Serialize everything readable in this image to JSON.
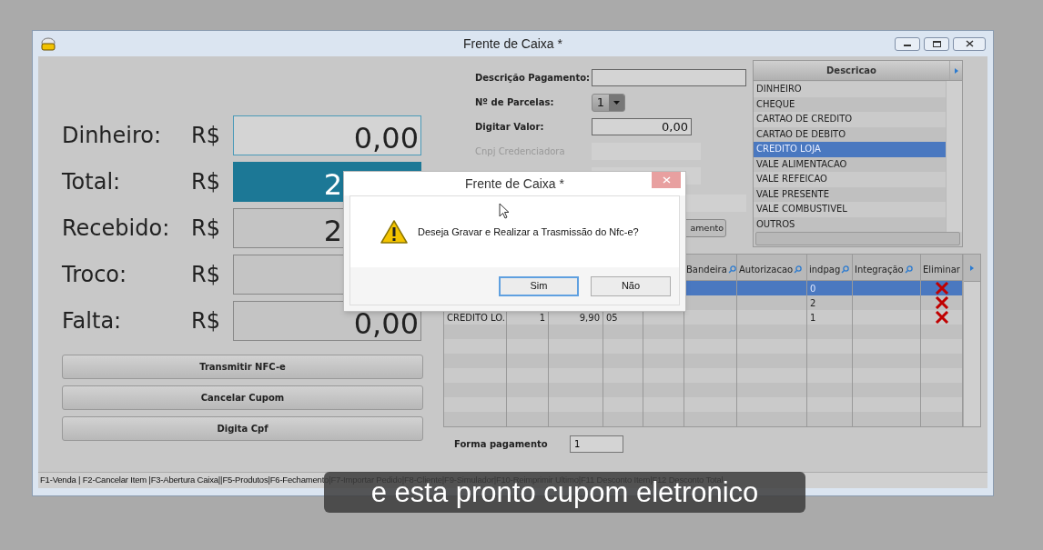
{
  "window": {
    "title": "Frente de Caixa  *"
  },
  "totals": [
    {
      "label": "Dinheiro:",
      "currency": "R$",
      "value": "0,00",
      "kind": "focused"
    },
    {
      "label": "Total:",
      "currency": "R$",
      "value": "2",
      "kind": "highlight"
    },
    {
      "label": "Recebido:",
      "currency": "R$",
      "value": "2",
      "kind": "plain"
    },
    {
      "label": "Troco:",
      "currency": "R$",
      "kind": "plain"
    },
    {
      "label": "Falta:",
      "currency": "R$",
      "value": "0,00",
      "kind": "plain"
    }
  ],
  "actions": [
    "Transmitir NFC-e",
    "Cancelar Cupom",
    "Digita Cpf"
  ],
  "payment_form": {
    "fields": [
      {
        "label": "Descrição Pagamento:",
        "kind": "text",
        "disabled": false
      },
      {
        "label": "Nº de Parcelas:",
        "kind": "combo",
        "value": "1",
        "disabled": false
      },
      {
        "label": "Digitar Valor:",
        "kind": "text",
        "value": "0,00",
        "disabled": false
      },
      {
        "label": "Cnpj Credenciadora",
        "kind": "text",
        "disabled": true
      },
      {
        "kind": "text",
        "disabled": true
      },
      {
        "kind": "wide",
        "disabled": true
      }
    ],
    "button": "amento"
  },
  "payment_list": {
    "header": "Descricao",
    "items": [
      {
        "label": "DINHEIRO",
        "selected": false
      },
      {
        "label": "CHEQUE",
        "selected": false
      },
      {
        "label": "CARTAO DE CREDITO",
        "selected": false
      },
      {
        "label": "CARTAO DE DEBITO",
        "selected": false
      },
      {
        "label": "CREDITO LOJA",
        "selected": true
      },
      {
        "label": "VALE ALIMENTACAO",
        "selected": false
      },
      {
        "label": "VALE REFEICAO",
        "selected": false
      },
      {
        "label": "VALE PRESENTE",
        "selected": false
      },
      {
        "label": "VALE COMBUSTIVEL",
        "selected": false
      },
      {
        "label": "OUTROS",
        "selected": false
      }
    ]
  },
  "grid": {
    "columns": [
      "Bandeira",
      "Autorizacao",
      "indpag",
      "Integração",
      "Eliminar"
    ],
    "rows": [
      {
        "selected": true,
        "indpag": "0",
        "removable": true
      },
      {
        "selected": false,
        "indpag": "2",
        "removable": true
      },
      {
        "selected": false,
        "column_1": "CREDITO LO.",
        "column_2": "1",
        "column_3": "9,90",
        "column_4": "05",
        "indpag": "1",
        "removable": true
      }
    ]
  },
  "forma_pagamento": {
    "label": "Forma pagamento",
    "value": "1"
  },
  "status_bar": "F1-Venda | F2-Cancelar Item |F3-Abertura Caixa||F5-Produtos|F6-Fechamento|F7-Importar Pedido|F8-Cliente|F9-Simulador|F10-Reimprimir Ultimo|F11 Desconto Item|F12 Desconto Total",
  "dialog": {
    "title": "Frente de Caixa  *",
    "message": "Deseja Gravar e Realizar a Trasmissão do Nfc-e?",
    "buttons": [
      {
        "label": "Sim",
        "selected": true
      },
      {
        "label": "Não",
        "selected": false
      }
    ]
  },
  "caption": "e esta pronto cupom eletronico"
}
